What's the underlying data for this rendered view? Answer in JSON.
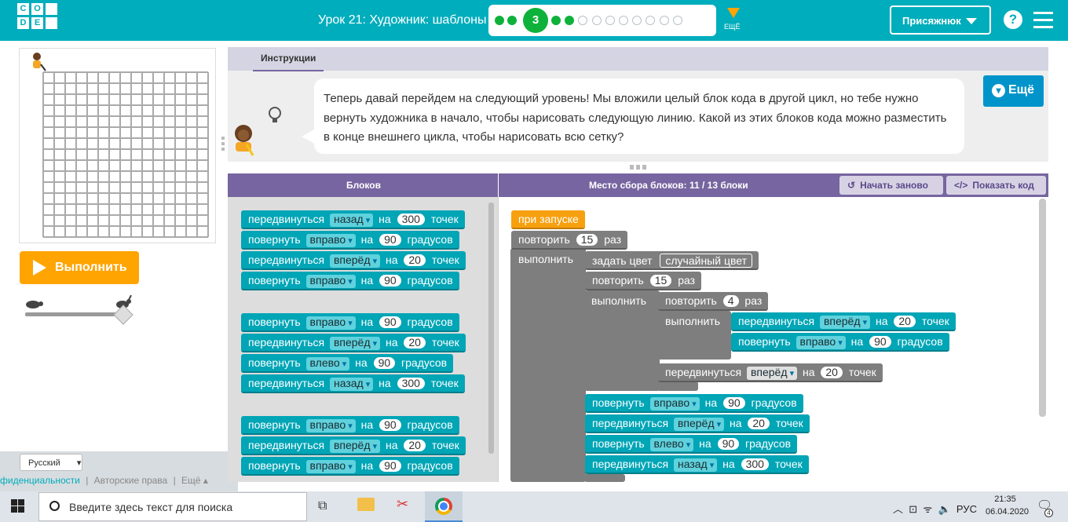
{
  "header": {
    "logo_letters": [
      "C",
      "O",
      "",
      "D",
      "E",
      ""
    ],
    "lesson_title": "Урок 21: Художник: шаблоны",
    "current_level": "3",
    "levels_before": 2,
    "levels_after": 10,
    "more_label": "ЕЩЁ",
    "user_name": "Присяжнюк",
    "help_icon": "?"
  },
  "left": {
    "run_label": "Выполнить",
    "language": "Русский",
    "footer_links": [
      "фиденциальности",
      "|",
      "Авторские права",
      "|",
      "Ещё ▴"
    ]
  },
  "instructions": {
    "tab_label": "Инструкции",
    "text": "Теперь давай перейдем на следующий уровень! Мы вложили целый блок кода в другой цикл, но тебе нужно вернуть художника в начало, чтобы нарисовать следующую линию. Какой из этих блоков кода можно разместить в конце внешнего цикла, чтобы нарисовать всю сетку?",
    "more_label": "Ещё"
  },
  "workspace_header": {
    "toolbox_title": "Блоков",
    "workspace_title": "Место сбора блоков: 11 / 13 блоки",
    "restart_label": "Начать заново",
    "show_code_label": "Показать код"
  },
  "words": {
    "move": "передвинуться",
    "turn": "повернуть",
    "on": "на",
    "points": "точек",
    "degrees": "градусов",
    "back": "назад",
    "forward": "вперёд",
    "right": "вправо",
    "left": "влево",
    "repeat": "повторить",
    "times": "раз",
    "do": "выполнить",
    "when_run": "при запуске",
    "set_color": "задать цвет",
    "random_color": "случайный цвет"
  },
  "toolbox_groups": [
    [
      {
        "verb": "передвинуться",
        "dir": "назад",
        "val": "300",
        "unit": "точек"
      },
      {
        "verb": "повернуть",
        "dir": "вправо",
        "val": "90",
        "unit": "градусов"
      },
      {
        "verb": "передвинуться",
        "dir": "вперёд",
        "val": "20",
        "unit": "точек"
      },
      {
        "verb": "повернуть",
        "dir": "вправо",
        "val": "90",
        "unit": "градусов"
      }
    ],
    [
      {
        "verb": "повернуть",
        "dir": "вправо",
        "val": "90",
        "unit": "градусов"
      },
      {
        "verb": "передвинуться",
        "dir": "вперёд",
        "val": "20",
        "unit": "точек"
      },
      {
        "verb": "повернуть",
        "dir": "влево",
        "val": "90",
        "unit": "градусов"
      },
      {
        "verb": "передвинуться",
        "dir": "назад",
        "val": "300",
        "unit": "точек"
      }
    ],
    [
      {
        "verb": "повернуть",
        "dir": "вправо",
        "val": "90",
        "unit": "градусов"
      },
      {
        "verb": "передвинуться",
        "dir": "вперёд",
        "val": "20",
        "unit": "точек"
      },
      {
        "verb": "повернуть",
        "dir": "вправо",
        "val": "90",
        "unit": "градусов"
      }
    ]
  ],
  "program": {
    "outer_repeat": "15",
    "mid_repeat": "15",
    "inner_repeat": "4",
    "inner_body": [
      {
        "verb": "передвинуться",
        "dir": "вперёд",
        "val": "20",
        "unit": "точек"
      },
      {
        "verb": "повернуть",
        "dir": "вправо",
        "val": "90",
        "unit": "градусов"
      }
    ],
    "after_inner": {
      "verb": "передвинуться",
      "dir": "вперёд",
      "val": "20",
      "unit": "точек"
    },
    "after_mid": [
      {
        "verb": "повернуть",
        "dir": "вправо",
        "val": "90",
        "unit": "градусов"
      },
      {
        "verb": "передвинуться",
        "dir": "вперёд",
        "val": "20",
        "unit": "точек"
      },
      {
        "verb": "повернуть",
        "dir": "влево",
        "val": "90",
        "unit": "градусов"
      },
      {
        "verb": "передвинуться",
        "dir": "назад",
        "val": "300",
        "unit": "точек"
      }
    ]
  },
  "taskbar": {
    "search_placeholder": "Введите здесь текст для поиска",
    "lang": "РУС",
    "time": "21:35",
    "date": "06.04.2020",
    "notification_count": "4"
  }
}
